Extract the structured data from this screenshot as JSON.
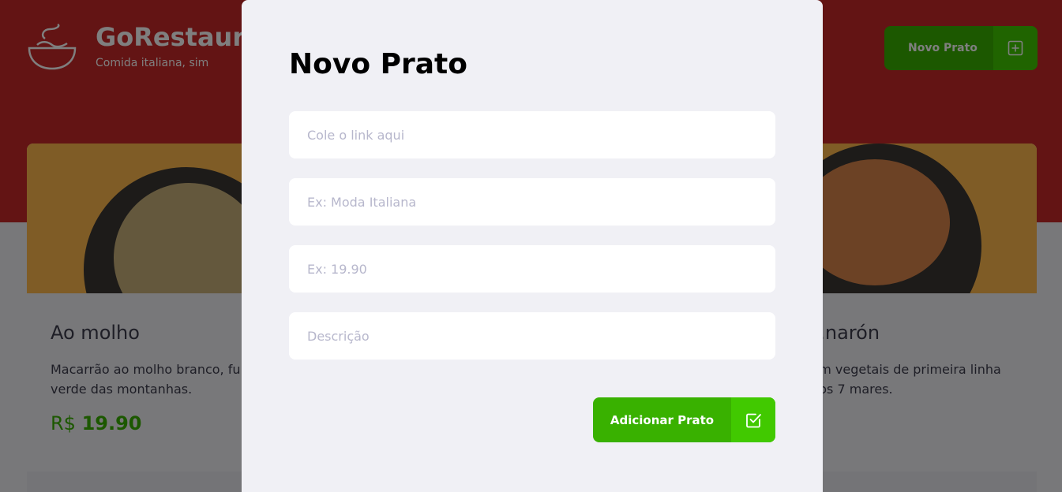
{
  "header": {
    "brand": "GoRestaurant",
    "tagline": "Comida italiana, sim",
    "new_dish_label": "Novo Prato",
    "new_dish_icon": "plus-square-icon",
    "logo_icon": "bowl-logo-icon"
  },
  "cards": [
    {
      "title": "Ao molho",
      "description": "Macarrão ao molho branco, fu... verde das montanhas.",
      "currency": "R$",
      "price": "19.90"
    },
    {
      "title": "...narón",
      "description": "...m vegetais de primeira linha ...os 7 mares."
    }
  ],
  "modal": {
    "title": "Novo Prato",
    "fields": [
      {
        "placeholder": "Cole o link aqui",
        "value": ""
      },
      {
        "placeholder": "Ex: Moda Italiana",
        "value": ""
      },
      {
        "placeholder": "Ex: 19.90",
        "value": ""
      },
      {
        "placeholder": "Descrição",
        "value": ""
      }
    ],
    "submit_label": "Adicionar Prato",
    "submit_icon": "check-square-icon"
  },
  "colors": {
    "header_red": "#c72828",
    "green_primary": "#39b100",
    "green_icon": "#41c900",
    "background": "#f0f0f5"
  }
}
